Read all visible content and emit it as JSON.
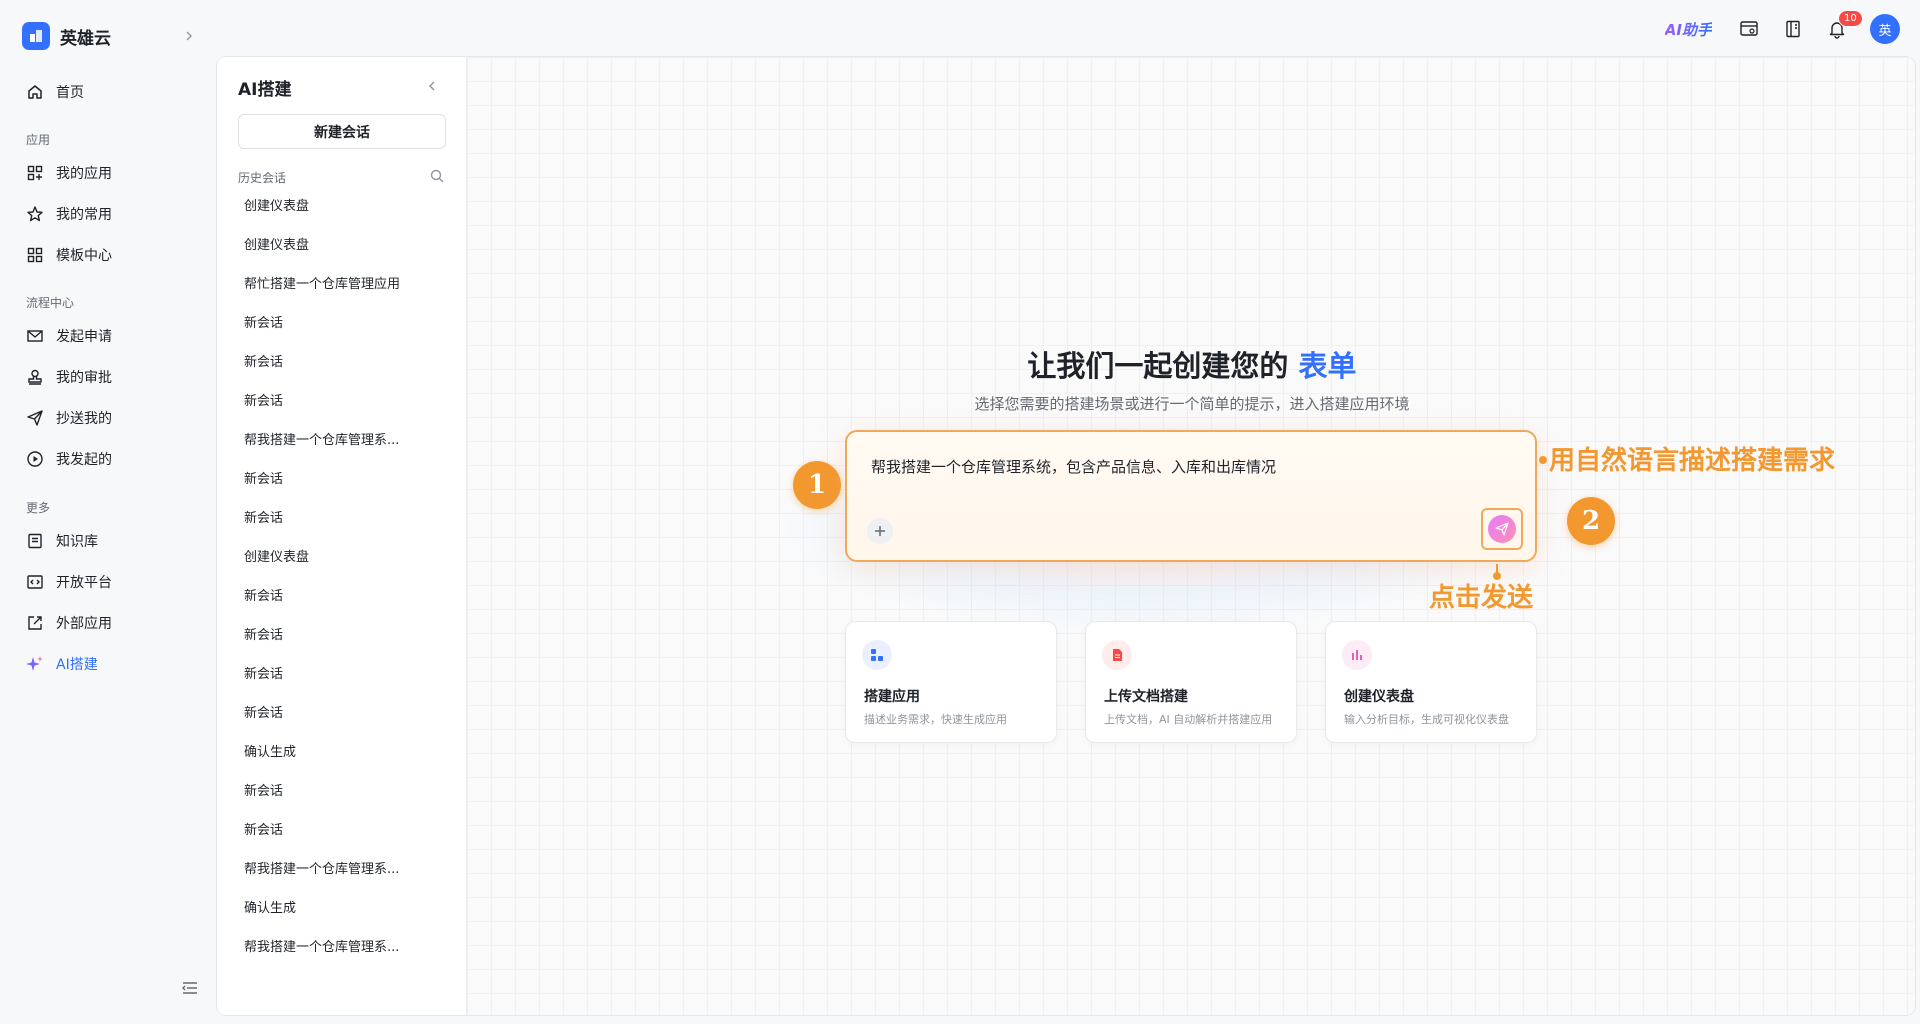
{
  "brand": {
    "name": "英雄云"
  },
  "nav": {
    "home": "首页",
    "sections": {
      "apps": "应用",
      "process": "流程中心",
      "more": "更多"
    },
    "items": {
      "my_apps": "我的应用",
      "favorites": "我的常用",
      "templates": "模板中心",
      "apply": "发起申请",
      "my_approval": "我的审批",
      "cc_me": "抄送我的",
      "initiated": "我发起的",
      "knowledge": "知识库",
      "open_platform": "开放平台",
      "external_apps": "外部应用",
      "ai_build": "AI搭建"
    }
  },
  "topbar": {
    "ai_helper": "AI助手",
    "notification_count": "10",
    "avatar": "英"
  },
  "history": {
    "title": "AI搭建",
    "new_chat": "新建会话",
    "label": "历史会话",
    "items": [
      "创建仪表盘",
      "创建仪表盘",
      "帮忙搭建一个仓库管理应用",
      "新会话",
      "新会话",
      "新会话",
      "帮我搭建一个仓库管理系...",
      "新会话",
      "新会话",
      "创建仪表盘",
      "新会话",
      "新会话",
      "新会话",
      "新会话",
      "确认生成",
      "新会话",
      "新会话",
      "帮我搭建一个仓库管理系...",
      "确认生成",
      "帮我搭建一个仓库管理系..."
    ]
  },
  "hero": {
    "title_prefix": "让我们一起创建您的",
    "title_accent": "表单",
    "subtitle": "选择您需要的搭建场景或进行一个简单的提示，进入搭建应用环境"
  },
  "prompt": {
    "value": "帮我搭建一个仓库管理系统，包含产品信息、入库和出库情况"
  },
  "annotations": {
    "step1": "1",
    "step2": "2",
    "step1_text": "用自然语言描述搭建需求",
    "step2_text": "点击发送",
    "color": "#f2982f"
  },
  "cards": [
    {
      "title": "搭建应用",
      "desc": "描述业务需求，快速生成应用"
    },
    {
      "title": "上传文档搭建",
      "desc": "上传文档，AI 自动解析并搭建应用"
    },
    {
      "title": "创建仪表盘",
      "desc": "输入分析目标，生成可视化仪表盘"
    }
  ],
  "colors": {
    "accent": "#3370ff",
    "annotation": "#f2982f"
  }
}
